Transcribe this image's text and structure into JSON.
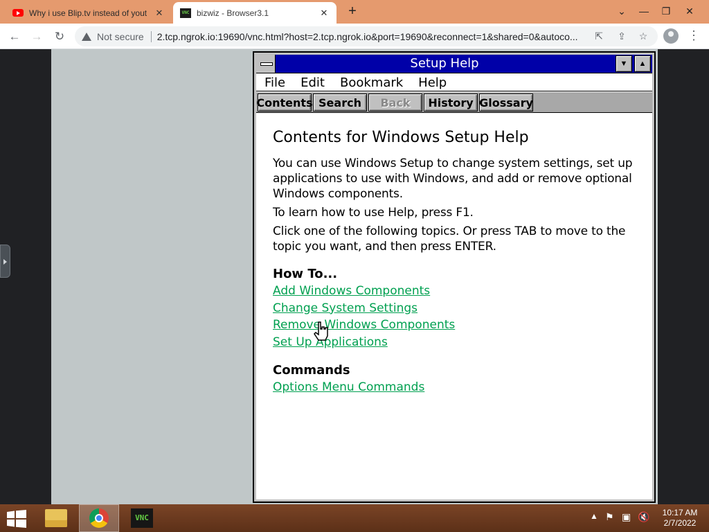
{
  "browser": {
    "tabs": [
      {
        "title": "Why i use Blip.tv instead of yout",
        "favicon": "youtube-icon",
        "close": "✕"
      },
      {
        "title": "bizwiz - Browser3.1",
        "favicon": "vnc-icon",
        "close": "✕"
      }
    ],
    "new_tab": "+",
    "window_controls": {
      "dropdown": "⌄",
      "minimize": "—",
      "restore": "❐",
      "close": "✕"
    },
    "security_label": "Not secure",
    "url": "2.tcp.ngrok.io:19690/vnc.html?host=2.tcp.ngrok.io&port=19690&reconnect=1&shared=0&autoco..."
  },
  "help": {
    "window_title": "Setup Help",
    "menu": [
      "File",
      "Edit",
      "Bookmark",
      "Help"
    ],
    "buttons": [
      {
        "label": "Contents",
        "enabled": true
      },
      {
        "label": "Search",
        "enabled": true
      },
      {
        "label": "Back",
        "enabled": false
      },
      {
        "label": "History",
        "enabled": true
      },
      {
        "label": "Glossary",
        "enabled": true
      }
    ],
    "heading": "Contents for Windows Setup Help",
    "paragraphs": [
      "You can use Windows Setup to change system settings, set up applications to use with Windows, and add or remove optional Windows components.",
      "To learn how to use Help, press F1.",
      "Click one of the following topics. Or press TAB to move to the topic you want, and then press ENTER."
    ],
    "howto_heading": "How To...",
    "howto_links": [
      "Add Windows Components",
      "Change System Settings",
      "Remove Windows Components",
      "Set Up Applications"
    ],
    "commands_heading": "Commands",
    "commands_links": [
      "Options Menu Commands"
    ],
    "link_color": "#00a050",
    "title_bar_color": "#0000a8"
  },
  "taskbar": {
    "vnc_label": "VNC",
    "time": "10:17 AM",
    "date": "2/7/2022"
  }
}
